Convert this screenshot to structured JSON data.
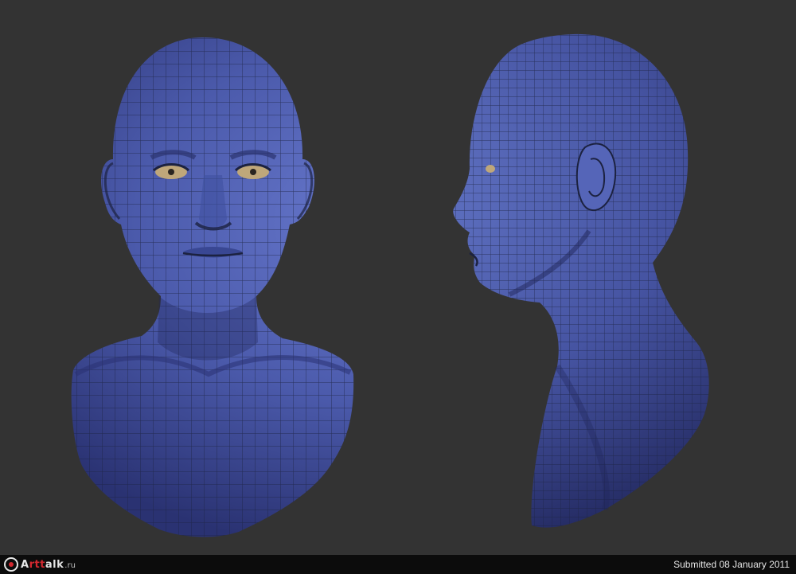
{
  "brand": {
    "logo_prefix": "A",
    "logo_accent": "rtt",
    "logo_tail": "alk",
    "logo_suffix": ".ru",
    "accent_color": "#d2282f"
  },
  "footer": {
    "submitted_text": "Submitted 08 January 2011"
  },
  "artwork": {
    "views": [
      "front-view-head-bust",
      "side-view-head-bust"
    ],
    "mesh_color": "#4a58a6",
    "wire_color": "#1c2240",
    "background_color": "#333333"
  }
}
